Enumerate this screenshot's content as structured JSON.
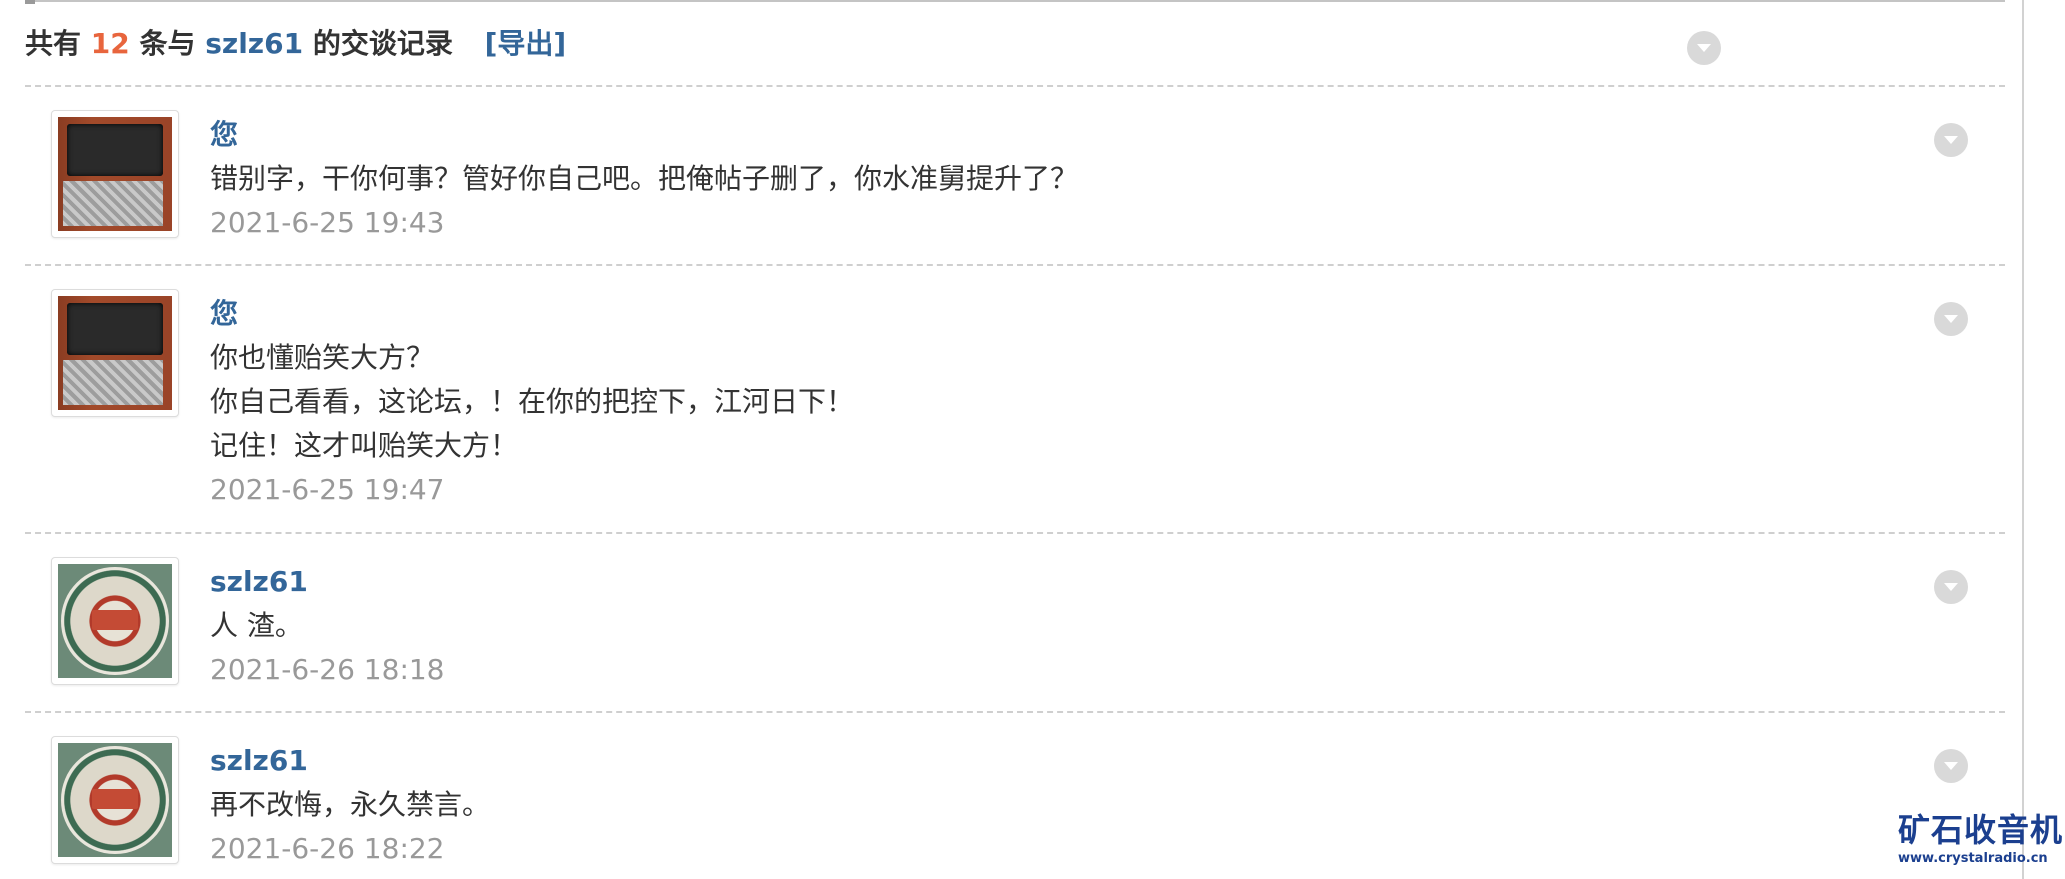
{
  "header": {
    "prefix": "共有",
    "count": "12",
    "mid": "条与",
    "username": "szlz61",
    "suffix": "的交谈记录",
    "export_label": "[导出]"
  },
  "messages": [
    {
      "sender": "您",
      "avatar": "battery-avatar",
      "lines": [
        "错别字，干你何事？管好你自己吧。把俺帖子删了，你水准舅提升了？"
      ],
      "time": "2021-6-25 19:43"
    },
    {
      "sender": "您",
      "avatar": "battery-avatar",
      "lines": [
        "你也懂贻笑大方？",
        "你自己看看，这论坛，！在你的把控下，江河日下！",
        "记住！这才叫贻笑大方！"
      ],
      "time": "2021-6-25 19:47"
    },
    {
      "sender": "szlz61",
      "avatar": "seal-avatar",
      "lines": [
        "人 渣。"
      ],
      "time": "2021-6-26 18:18"
    },
    {
      "sender": "szlz61",
      "avatar": "seal-avatar",
      "lines": [
        "再不改悔，永久禁言。"
      ],
      "time": "2021-6-26 18:22"
    }
  ],
  "watermark": {
    "name": "矿石收音机",
    "url": "www.crystalradio.cn"
  },
  "colors": {
    "link": "#336699",
    "count": "#e8653d",
    "text": "#333333",
    "timestamp": "#999999",
    "watermark": "#1b3f8f"
  },
  "icons": {
    "collapse": "chevron-down-circle-icon"
  }
}
